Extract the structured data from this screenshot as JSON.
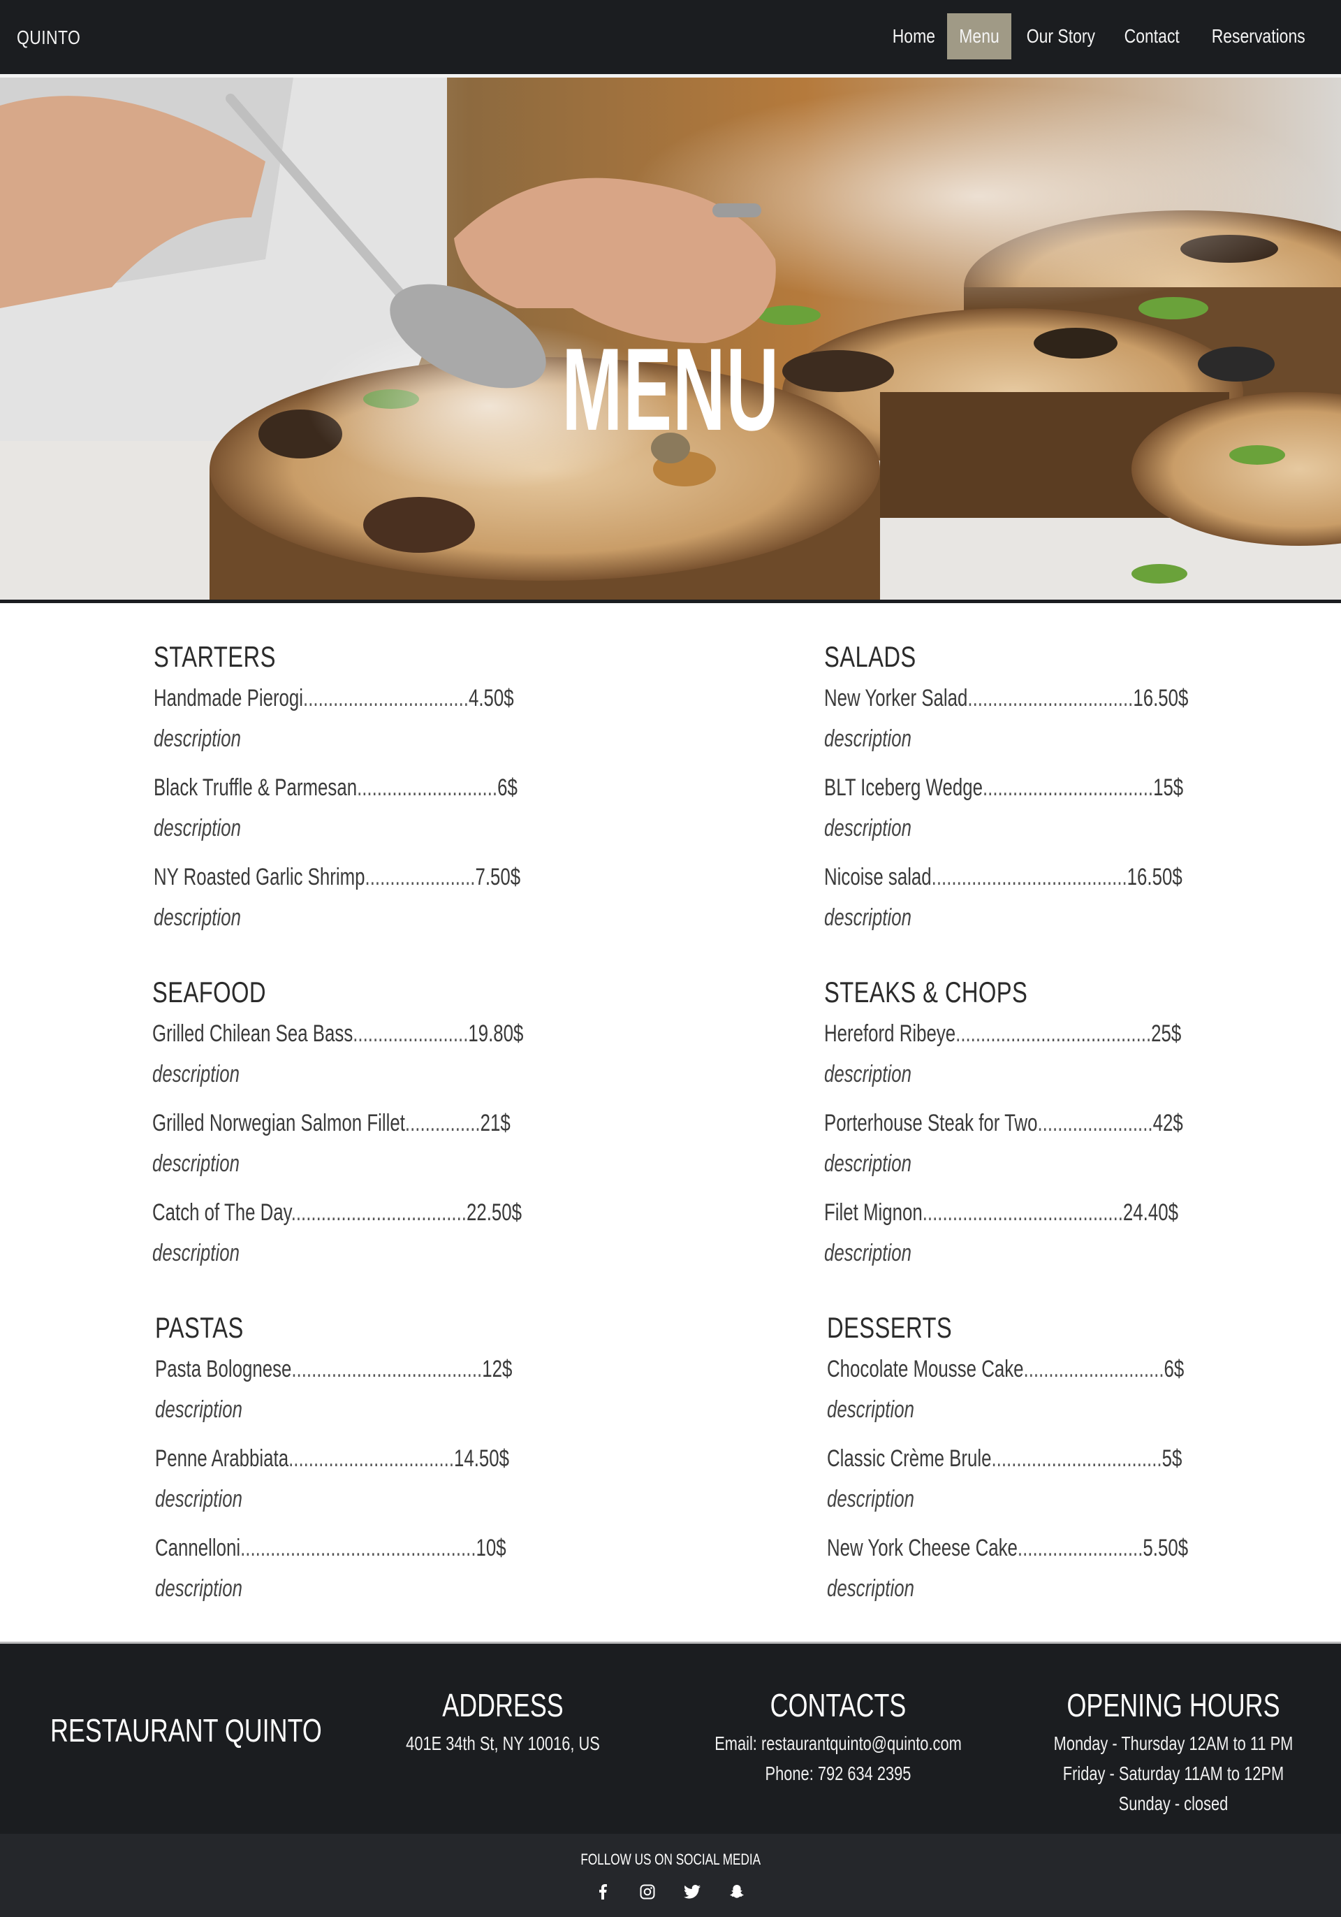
{
  "nav": {
    "brand": "QUINTO",
    "links": [
      "Home",
      "Menu",
      "Our Story",
      "Contact",
      "Reservations"
    ],
    "active": "Menu"
  },
  "hero": {
    "title": "MENU"
  },
  "menu": {
    "starters": {
      "title": "STARTERS",
      "items": [
        {
          "name": "Handmade Pierogi",
          "dots": ".................................",
          "price": "4.50$",
          "desc": "description"
        },
        {
          "name": "Black Truffle & Parmesan",
          "dots": "............................",
          "price": "6$",
          "desc": "description"
        },
        {
          "name": "NY Roasted Garlic Shrimp",
          "dots": "......................",
          "price": "7.50$",
          "desc": "description"
        }
      ]
    },
    "salads": {
      "title": "SALADS",
      "items": [
        {
          "name": "New Yorker Salad",
          "dots": ".................................",
          "price": "16.50$",
          "desc": "description"
        },
        {
          "name": "BLT Iceberg Wedge",
          "dots": "..................................",
          "price": "15$",
          "desc": "description"
        },
        {
          "name": "Nicoise salad",
          "dots": ".......................................",
          "price": "16.50$",
          "desc": "description"
        }
      ]
    },
    "seafood": {
      "title": "SEAFOOD",
      "items": [
        {
          "name": "Grilled Chilean Sea Bass",
          "dots": ".......................",
          "price": "19.80$",
          "desc": "description"
        },
        {
          "name": "Grilled Norwegian Salmon Fillet",
          "dots": "...............",
          "price": "21$",
          "desc": "description"
        },
        {
          "name": "Catch of The Day",
          "dots": "...................................",
          "price": "22.50$",
          "desc": "description"
        }
      ]
    },
    "steaks": {
      "title": "STEAKS & CHOPS",
      "items": [
        {
          "name": "Hereford Ribeye",
          "dots": ".......................................",
          "price": "25$",
          "desc": "description"
        },
        {
          "name": "Porterhouse Steak for Two",
          "dots": ".......................",
          "price": "42$",
          "desc": "description"
        },
        {
          "name": "Filet Mignon",
          "dots": "........................................",
          "price": "24.40$",
          "desc": "description"
        }
      ]
    },
    "pastas": {
      "title": "PASTAS",
      "items": [
        {
          "name": "Pasta Bolognese",
          "dots": "......................................",
          "price": "12$",
          "desc": "description"
        },
        {
          "name": "Penne Arabbiata",
          "dots": ".................................",
          "price": "14.50$",
          "desc": "description"
        },
        {
          "name": "Cannelloni",
          "dots": "...............................................",
          "price": "10$",
          "desc": "description"
        }
      ]
    },
    "desserts": {
      "title": "DESSERTS",
      "items": [
        {
          "name": "Chocolate Mousse Cake",
          "dots": "............................",
          "price": "6$",
          "desc": "description"
        },
        {
          "name": "Classic Crème Brule",
          "dots": "..................................",
          "price": "5$",
          "desc": "description"
        },
        {
          "name": "New York Cheese Cake",
          "dots": ".........................",
          "price": "5.50$",
          "desc": "description"
        }
      ]
    }
  },
  "footer": {
    "name": "RESTAURANT QUINTO",
    "address": {
      "title": "ADDRESS",
      "line": "401E 34th St, NY 10016, US"
    },
    "contacts": {
      "title": "CONTACTS",
      "email": "Email: restaurantquinto@quinto.com",
      "phone": "Phone: 792 634 2395"
    },
    "hours": {
      "title": "OPENING HOURS",
      "lines": [
        "Monday - Thursday 12AM to 11 PM",
        "Friday - Saturday 11AM to 12PM",
        "Sunday - closed"
      ]
    },
    "social_label": "FOLLOW US ON SOCIAL MEDIA",
    "social_icons": [
      "facebook-icon",
      "instagram-icon",
      "twitter-icon",
      "snapchat-icon"
    ]
  }
}
